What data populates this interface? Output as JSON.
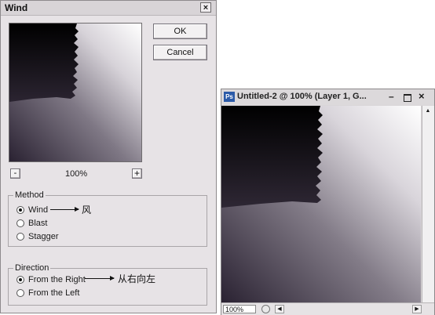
{
  "dialog": {
    "title": "Wind",
    "close_glyph": "×",
    "ok_label": "OK",
    "cancel_label": "Cancel",
    "zoom": {
      "minus_glyph": "-",
      "level": "100%",
      "plus_glyph": "+"
    },
    "method": {
      "legend": "Method",
      "options": [
        {
          "label": "Wind",
          "selected": true
        },
        {
          "label": "Blast",
          "selected": false
        },
        {
          "label": "Stagger",
          "selected": false
        }
      ]
    },
    "direction": {
      "legend": "Direction",
      "options": [
        {
          "label": "From the Right",
          "selected": true
        },
        {
          "label": "From the Left",
          "selected": false
        }
      ]
    }
  },
  "annotations": {
    "wind_cn": "风",
    "right_cn": "从右向左"
  },
  "document": {
    "app_icon": "Ps",
    "title": "Untitled-2 @ 100% (Layer 1, G...",
    "minimize_glyph": "–",
    "close_glyph": "×",
    "zoom_field": "100%",
    "scroll_left_glyph": "◀",
    "scroll_right_glyph": "▶",
    "scroll_up_glyph": "▲"
  },
  "icons": [
    "close-icon",
    "minus-icon",
    "plus-icon",
    "photoshop-icon",
    "minimize-icon",
    "maximize-icon",
    "status-icon",
    "arrow-right-icon"
  ]
}
